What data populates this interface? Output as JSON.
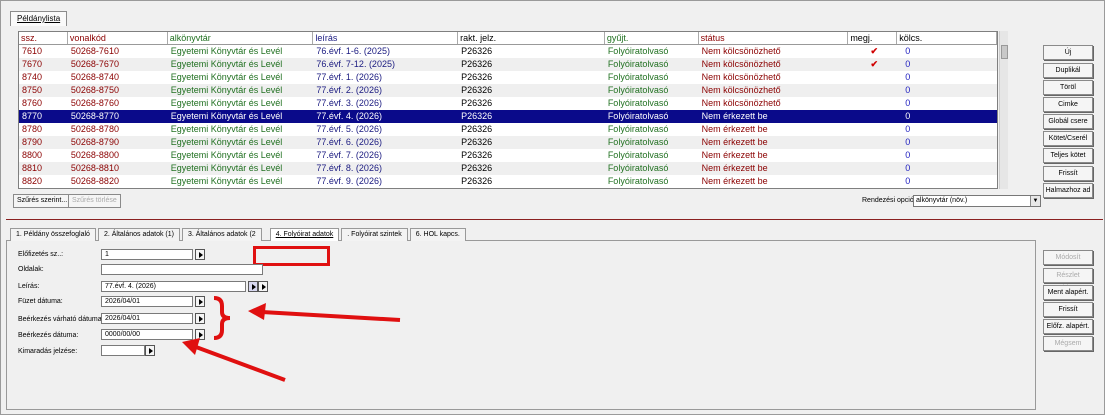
{
  "window_tab": "Példánylista",
  "table": {
    "headers": [
      "ssz.",
      "vonalkód",
      "alkönyvtár",
      "leírás",
      "rakt. jelz.",
      "gyűjt.",
      "státus",
      "megj.",
      "kölcs."
    ],
    "rows": [
      [
        "7610",
        "50268-7610",
        "Egyetemi Könyvtár és Levél",
        "76.évf. 1-6. (2025)",
        "P26326",
        "Folyóiratolvasó",
        "Nem kölcsönözhető",
        "✔",
        "0"
      ],
      [
        "7670",
        "50268-7670",
        "Egyetemi Könyvtár és Levél",
        "76.évf. 7-12. (2025)",
        "P26326",
        "Folyóiratolvasó",
        "Nem kölcsönözhető",
        "✔",
        "0"
      ],
      [
        "8740",
        "50268-8740",
        "Egyetemi Könyvtár és Levél",
        "77.évf. 1. (2026)",
        "P26326",
        "Folyóiratolvasó",
        "Nem kölcsönözhető",
        "",
        "0"
      ],
      [
        "8750",
        "50268-8750",
        "Egyetemi Könyvtár és Levél",
        "77.évf. 2. (2026)",
        "P26326",
        "Folyóiratolvasó",
        "Nem kölcsönözhető",
        "",
        "0"
      ],
      [
        "8760",
        "50268-8760",
        "Egyetemi Könyvtár és Levél",
        "77.évf. 3. (2026)",
        "P26326",
        "Folyóiratolvasó",
        "Nem kölcsönözhető",
        "",
        "0"
      ],
      [
        "8770",
        "50268-8770",
        "Egyetemi Könyvtár és Levél",
        "77.évf. 4. (2026)",
        "P26326",
        "Folyóiratolvasó",
        "Nem érkezett be",
        "",
        "0"
      ],
      [
        "8780",
        "50268-8780",
        "Egyetemi Könyvtár és Levél",
        "77.évf. 5. (2026)",
        "P26326",
        "Folyóiratolvasó",
        "Nem érkezett be",
        "",
        "0"
      ],
      [
        "8790",
        "50268-8790",
        "Egyetemi Könyvtár és Levél",
        "77.évf. 6. (2026)",
        "P26326",
        "Folyóiratolvasó",
        "Nem érkezett be",
        "",
        "0"
      ],
      [
        "8800",
        "50268-8800",
        "Egyetemi Könyvtár és Levél",
        "77.évf. 7. (2026)",
        "P26326",
        "Folyóiratolvasó",
        "Nem érkezett be",
        "",
        "0"
      ],
      [
        "8810",
        "50268-8810",
        "Egyetemi Könyvtár és Levél",
        "77.évf. 8. (2026)",
        "P26326",
        "Folyóiratolvasó",
        "Nem érkezett be",
        "",
        "0"
      ],
      [
        "8820",
        "50268-8820",
        "Egyetemi Könyvtár és Levél",
        "77.évf. 9. (2026)",
        "P26326",
        "Folyóiratolvasó",
        "Nem érkezett be",
        "",
        "0"
      ]
    ]
  },
  "right_buttons": [
    "Új",
    "Duplikál",
    "Töröl",
    "Cimke",
    "Globál csere",
    "Kötet/Cserél",
    "Teljes kötet",
    "Frissít",
    "Halmazhoz ad"
  ],
  "filter": {
    "apply": "Szűrés szerint...",
    "clear": "Szűrés törlése"
  },
  "sort": {
    "label": "Rendezési opciók",
    "value": "alkönyvtár (növ.)"
  },
  "tabs": [
    "1. Példány összefoglaló",
    "2. Általános adatok (1)",
    "3. Általános adatok (2",
    "4. Folyóirat adatok",
    ". Folyóirat szintek",
    "6. HOL kapcs."
  ],
  "form": {
    "elofizetes": {
      "label": "Előfizetés sz..:",
      "value": "1"
    },
    "oldalak": {
      "label": "Oldalak:",
      "value": ""
    },
    "leiras": {
      "label": "Leírás:",
      "value": "77.évf. 4. (2026)"
    },
    "fuzet": {
      "label": "Füzet dátuma:",
      "value": "2026/04/01"
    },
    "varhato": {
      "label": "Beérkezés várható dátuma:",
      "value": "2026/04/01"
    },
    "beerkezes": {
      "label": "Beérkezés dátuma:",
      "value": "0000/00/00"
    },
    "kimaradas": {
      "label": "Kimaradás jelzése:",
      "value": ""
    }
  },
  "bottom_buttons": [
    {
      "label": "Módosít",
      "disabled": true
    },
    {
      "label": "Részlet Többszö",
      "disabled": true
    },
    {
      "label": "Ment alapért.",
      "disabled": false
    },
    {
      "label": "Frissít",
      "disabled": false
    },
    {
      "label": "Előfz. alapért.",
      "disabled": false
    },
    {
      "label": "Mégsem",
      "disabled": true
    }
  ]
}
